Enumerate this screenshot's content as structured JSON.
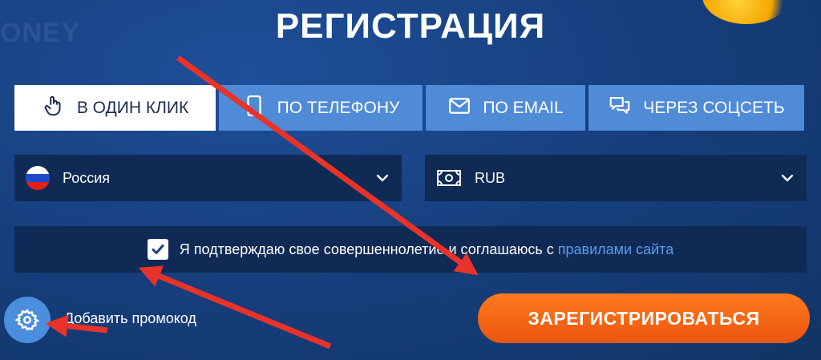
{
  "page": {
    "title": "РЕГИСТРАЦИЯ",
    "watermark": "ONEY"
  },
  "tabs": [
    {
      "label": "В ОДИН КЛИК",
      "icon": "hand-pointer-icon",
      "active": true
    },
    {
      "label": "ПО ТЕЛЕФОНУ",
      "icon": "phone-icon",
      "active": false
    },
    {
      "label": "ПО EMAIL",
      "icon": "envelope-icon",
      "active": false
    },
    {
      "label": "ЧЕРЕЗ СОЦСЕТЬ",
      "icon": "chat-bubbles-icon",
      "active": false
    }
  ],
  "country": {
    "value": "Россия",
    "icon": "russia-flag-icon"
  },
  "currency": {
    "value": "RUB",
    "icon": "money-bill-icon"
  },
  "agreement": {
    "checked": true,
    "text": "Я подтверждаю свое совершеннолетие и соглашаюсь с",
    "link": "правилами сайта"
  },
  "promo": {
    "label": "Добавить промокод",
    "icon": "gear-icon"
  },
  "submit": {
    "label": "ЗАРЕГИСТРИРОВАТЬСЯ"
  },
  "colors": {
    "background": "#17407f",
    "tab_inactive": "#4f8bd6",
    "tab_active": "#ffffff",
    "field_bg": "#0f2a55",
    "link": "#5b9eea",
    "submit": "#f26a1b",
    "annotation_arrow": "#e8332a"
  }
}
